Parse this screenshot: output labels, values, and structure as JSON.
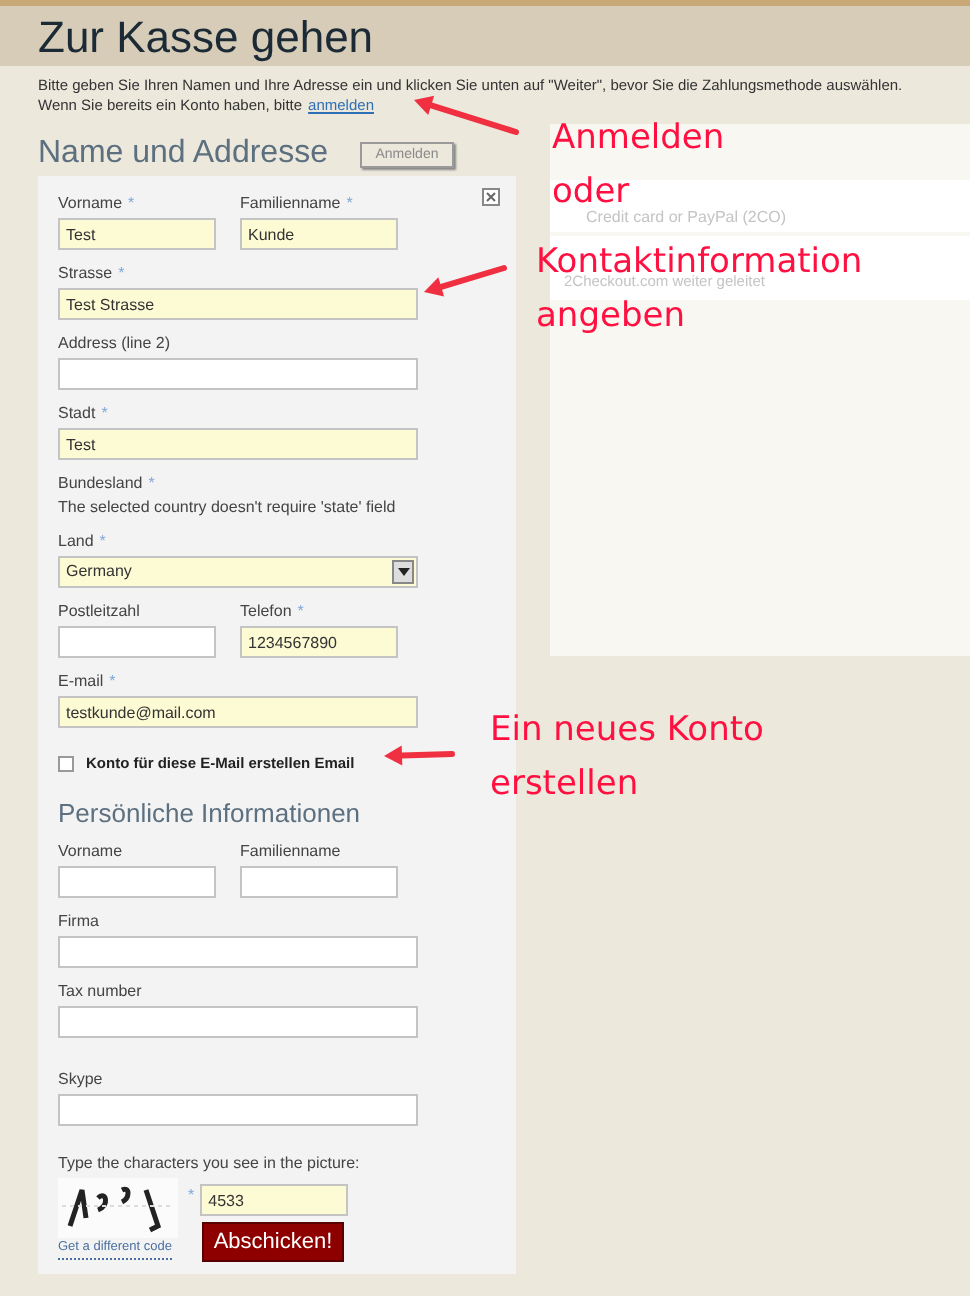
{
  "header": {
    "title": "Zur Kasse gehen"
  },
  "intro": {
    "line_1": "Bitte geben Sie Ihren Namen und Ihre Adresse ein und klicken Sie unten auf \"Weiter\", bevor Sie die Zahlungsmethode auswählen.",
    "line_2": "Wenn Sie bereits ein Konto haben, bitte",
    "login_link": "anmelden"
  },
  "address_section": {
    "title": "Name und Addresse",
    "login_button": "Anmelden",
    "rows": [
      [
        {
          "kind": "short",
          "label": "Vorname",
          "required_mark": "*",
          "value": "Test"
        },
        {
          "kind": "short",
          "label": "Familienname",
          "required_mark": "*",
          "value": "Kunde"
        }
      ],
      [
        {
          "kind": "long",
          "label": "Strasse",
          "required_mark": "*",
          "value": "Test Strasse"
        }
      ],
      [
        {
          "kind": "long",
          "label": "Address (line 2)"
        }
      ],
      [
        {
          "kind": "long",
          "label": "Stadt",
          "required_mark": "*",
          "value": "Test"
        }
      ],
      [
        {
          "kind": "note",
          "label": "Bundesland",
          "required_mark": "*",
          "note": "The selected country doesn't require 'state' field"
        }
      ],
      [
        {
          "kind": "select",
          "label": "Land",
          "required_mark": "*",
          "value": "Germany"
        }
      ],
      [
        {
          "kind": "short",
          "label": "Postleitzahl"
        },
        {
          "kind": "short",
          "label": "Telefon",
          "required_mark": "*",
          "value": "1234567890"
        }
      ],
      [
        {
          "kind": "long",
          "label": "E-mail",
          "required_mark": "*",
          "value": "testkunde@mail.com"
        }
      ]
    ],
    "create_account": {
      "label": "Konto für diese E-Mail erstellen Email",
      "checked": false
    }
  },
  "personal_section": {
    "title": "Persönliche Informationen",
    "rows": [
      [
        {
          "kind": "short",
          "label": "Vorname"
        },
        {
          "kind": "short",
          "label": "Familienname"
        }
      ],
      [
        {
          "kind": "long",
          "label": "Firma"
        }
      ],
      [
        {
          "kind": "long",
          "label": "Tax number"
        }
      ],
      [
        {
          "kind": "long",
          "label": "Skype"
        }
      ]
    ]
  },
  "captcha": {
    "label": "Type the characters you see in the picture:",
    "new_code_link": "Get a different code",
    "required_mark": "*",
    "value": "4533"
  },
  "submit_button": "Abschicken!",
  "payment_section": {
    "option_detail": "Credit card or PayPal (2CO)",
    "description_line_3": "2Checkout.com weiter geleitet"
  },
  "annotations": [
    {
      "lines": [
        "Anmelden",
        "oder"
      ]
    },
    {
      "lines": [
        "Kontaktinformation",
        "angeben"
      ]
    },
    {
      "lines": [
        "Ein neues Konto",
        "erstellen"
      ]
    }
  ]
}
